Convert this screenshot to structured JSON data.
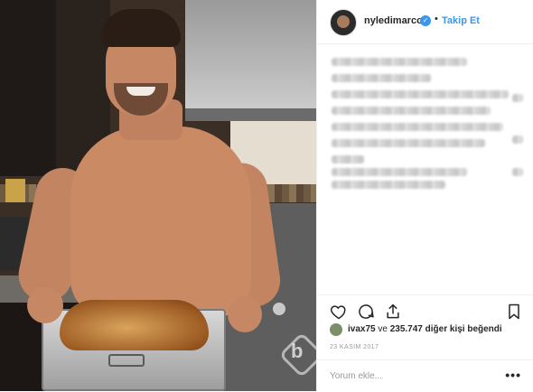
{
  "post": {
    "author": "nyledimarco",
    "separator": "•",
    "follow_label": "Takip Et",
    "verified_glyph": "✓"
  },
  "actions": {
    "like_icon": "heart-icon",
    "comment_icon": "comment-icon",
    "share_icon": "share-icon",
    "save_icon": "bookmark-icon"
  },
  "likes": {
    "user": "ivax75",
    "connector": " ve ",
    "count": "235.747",
    "suffix": " diğer kişi beğendi"
  },
  "date": "23 KASIM 2017",
  "comment": {
    "placeholder": "Yorum ekle...",
    "more": "•••"
  },
  "watermark_glyph": "b",
  "colors": {
    "link_blue": "#3897f0",
    "text": "#262626",
    "muted": "#999999",
    "border": "#efefef"
  }
}
